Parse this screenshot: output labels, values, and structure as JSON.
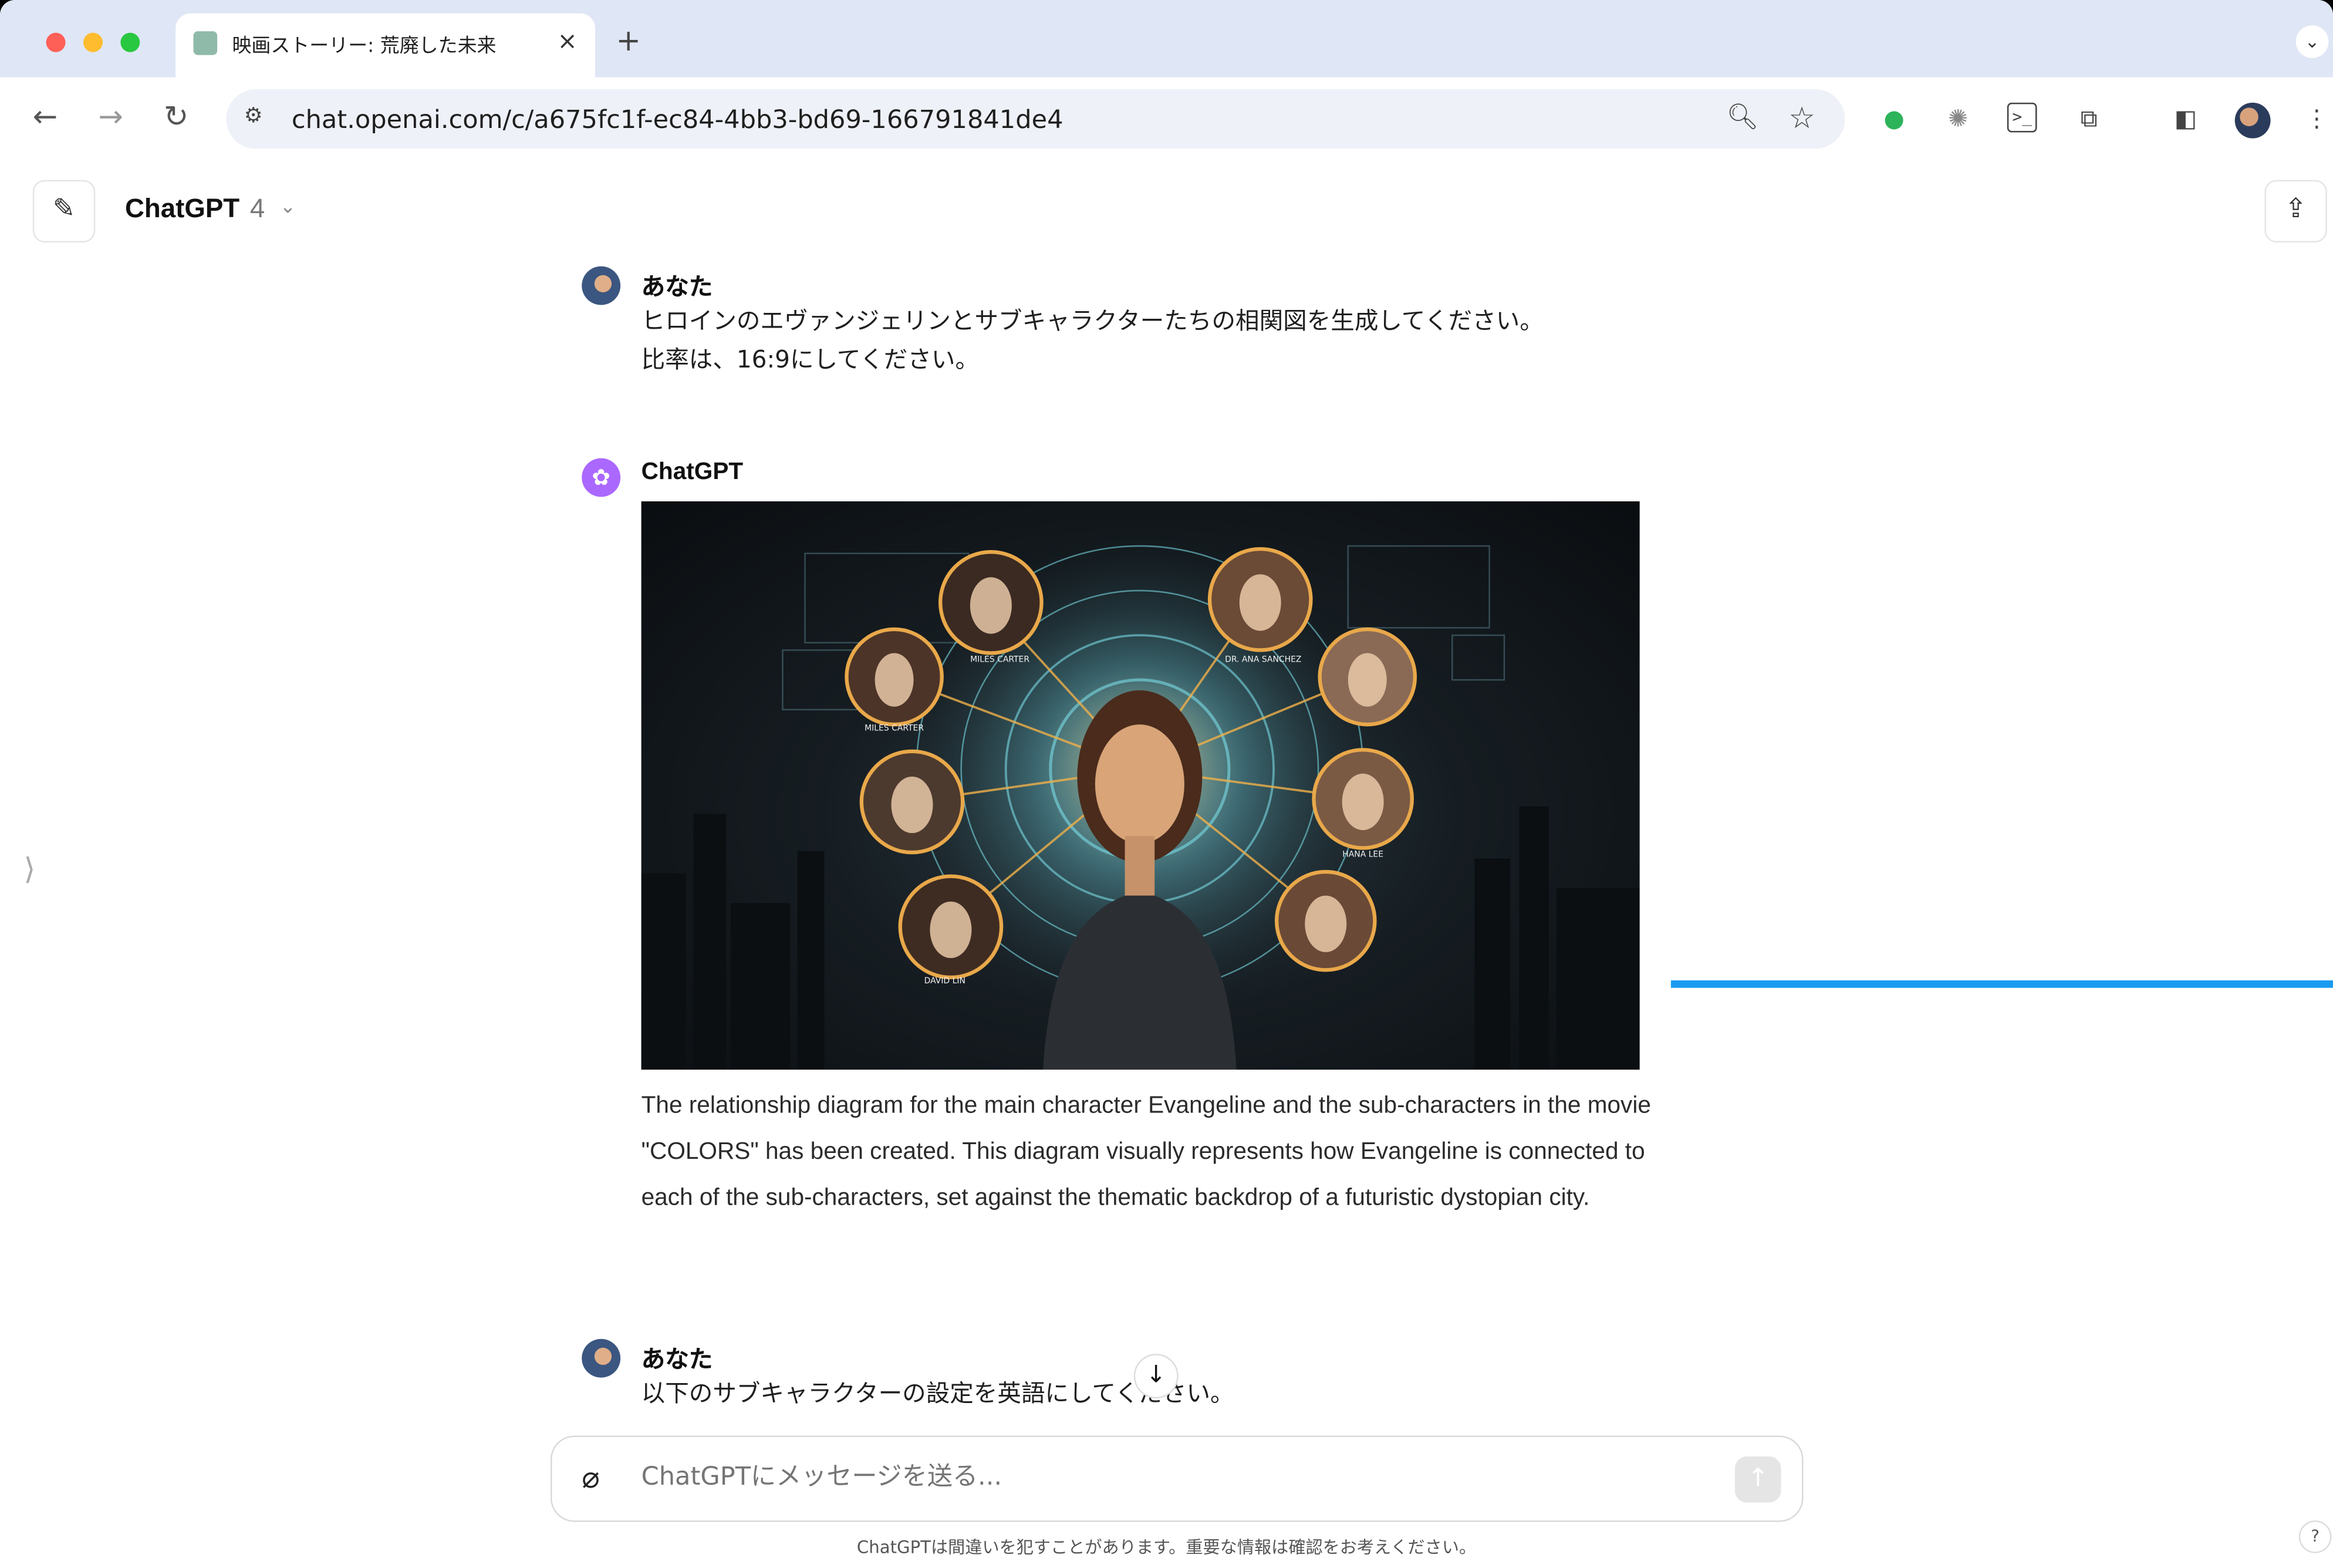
{
  "browser": {
    "tab_title": "映画ストーリー: 荒廃した未来",
    "tab_close": "×",
    "new_tab": "+",
    "url": "chat.openai.com/c/a675fc1f-ec84-4bb3-bd69-166791841de4",
    "icons": [
      "back-icon",
      "forward-icon",
      "reload-icon",
      "site-info-icon",
      "zoom-icon",
      "bookmark-star-icon",
      "evernote-icon",
      "extension-icon",
      "terminal-icon",
      "puzzle-icon",
      "side-panel-icon",
      "profile-avatar",
      "menu-icon"
    ]
  },
  "header": {
    "model": "ChatGPT",
    "model_version": "4"
  },
  "messages": [
    {
      "author": "あなた",
      "lines": [
        "ヒロインのエヴァンジェリンとサブキャラクターたちの相関図を生成してください。",
        "比率は、16:9にしてください。"
      ]
    },
    {
      "author": "ChatGPT",
      "image_labels": [
        "MILES CARTER",
        "DR. ANA SANCHEZ",
        "MILES CARTER",
        "DAVID LIN",
        "HANA LEE"
      ],
      "text": "The relationship diagram for the main character Evangeline and the sub-characters in the movie \"COLORS\" has been created. This diagram visually represents how Evangeline is connected to each of the sub-characters, set against the thematic backdrop of a futuristic dystopian city."
    },
    {
      "author": "あなた",
      "lines": [
        "以下のサブキャラクターの設定を英語にしてください。"
      ]
    }
  ],
  "composer": {
    "placeholder": "ChatGPTにメッセージを送る..."
  },
  "disclaimer": "ChatGPTは間違いを犯すことがあります。重要な情報は確認をお考えください。",
  "help": "?",
  "colors": {
    "accent_blue": "#1a9bf0",
    "gpt_purple": "#ab68ff",
    "tabstrip": "#dfe6f5"
  }
}
